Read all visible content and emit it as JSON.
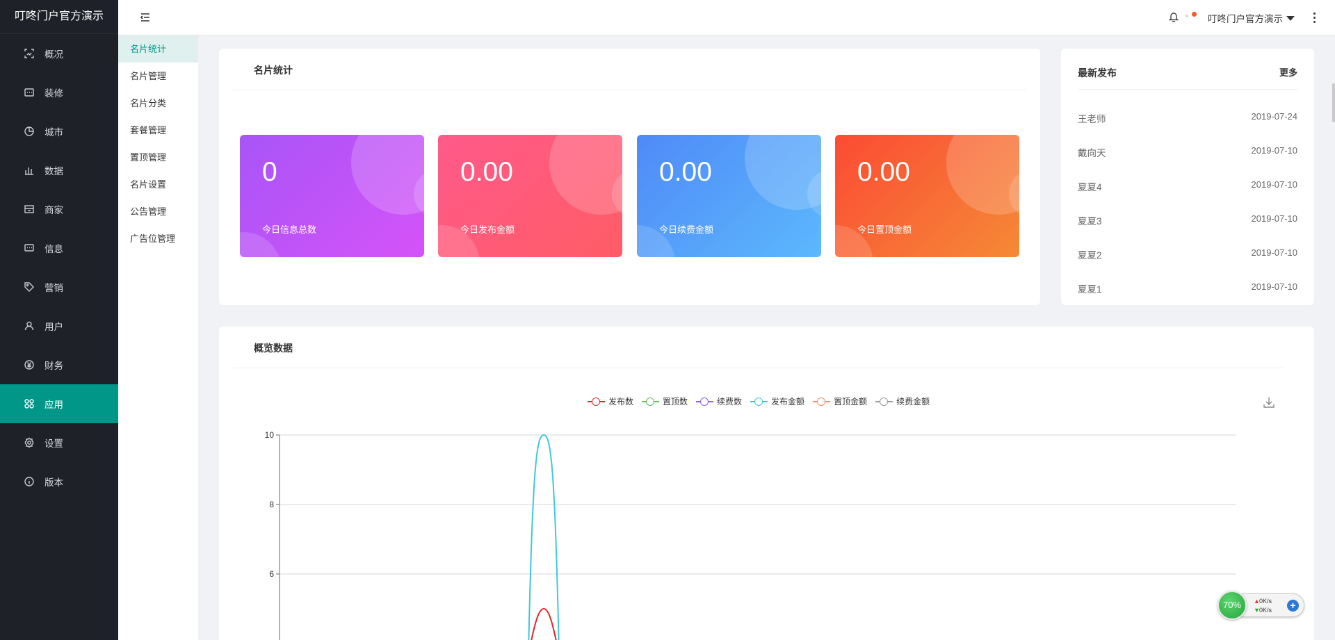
{
  "app": {
    "brand": "叮咚门户官方演示"
  },
  "sidebar": {
    "items": [
      {
        "label": "概况",
        "icon": "overview-icon"
      },
      {
        "label": "装修",
        "icon": "decorate-icon"
      },
      {
        "label": "城市",
        "icon": "city-icon"
      },
      {
        "label": "数据",
        "icon": "data-icon"
      },
      {
        "label": "商家",
        "icon": "merchant-icon"
      },
      {
        "label": "信息",
        "icon": "message-icon"
      },
      {
        "label": "营销",
        "icon": "tag-icon"
      },
      {
        "label": "用户",
        "icon": "user-icon"
      },
      {
        "label": "财务",
        "icon": "yen-icon"
      },
      {
        "label": "应用",
        "icon": "apps-icon",
        "active": true
      },
      {
        "label": "设置",
        "icon": "settings-icon"
      },
      {
        "label": "版本",
        "icon": "info-icon"
      }
    ]
  },
  "header": {
    "user_name": "叮咚门户官方演示",
    "bell_sep": "·"
  },
  "subnav": {
    "items": [
      "名片统计",
      "名片管理",
      "名片分类",
      "套餐管理",
      "置顶管理",
      "名片设置",
      "公告管理",
      "广告位管理"
    ],
    "active_index": 0
  },
  "stats_card": {
    "title": "名片统计",
    "stats": [
      {
        "value": "0",
        "label": "今日信息总数",
        "color": "#c252f8"
      },
      {
        "value": "0.00",
        "label": "今日发布金额",
        "color": "#ff5a78"
      },
      {
        "value": "0.00",
        "label": "今日续费金额",
        "color": "#56a2fa"
      },
      {
        "value": "0.00",
        "label": "今日置顶金额",
        "color": "#f86a35"
      }
    ]
  },
  "latest": {
    "title": "最新发布",
    "more": "更多",
    "items": [
      {
        "name": "王老师",
        "date": "2019-07-24"
      },
      {
        "name": "戴向天",
        "date": "2019-07-10"
      },
      {
        "name": "夏夏4",
        "date": "2019-07-10"
      },
      {
        "name": "夏夏3",
        "date": "2019-07-10"
      },
      {
        "name": "夏夏2",
        "date": "2019-07-10"
      },
      {
        "name": "夏夏1",
        "date": "2019-07-10"
      }
    ]
  },
  "overview": {
    "title": "概览数据"
  },
  "chart_data": {
    "type": "line",
    "legend_position": "top-center",
    "grid": true,
    "yticks": [
      "6",
      "8",
      "10"
    ],
    "ylim_visible": [
      4,
      10
    ],
    "series": [
      {
        "name": "发布数",
        "color": "#e3242b",
        "peak": 5
      },
      {
        "name": "置顶数",
        "color": "#5cc060",
        "peak": 0
      },
      {
        "name": "续费数",
        "color": "#8e5cf0",
        "peak": 0
      },
      {
        "name": "发布金额",
        "color": "#3fc8dc",
        "peak": 10
      },
      {
        "name": "置顶金额",
        "color": "#f08d5c",
        "peak": 0
      },
      {
        "name": "续费金额",
        "color": "#999999",
        "peak": 0
      }
    ]
  },
  "net_widget": {
    "percent": "70%",
    "up": "0K/s",
    "down": "0K/s"
  }
}
